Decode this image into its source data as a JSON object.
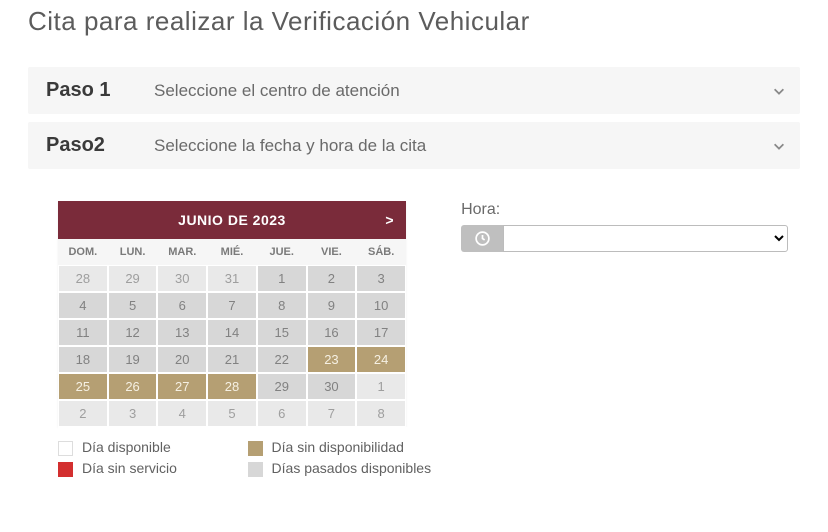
{
  "title": "Cita para realizar la Verificación Vehicular",
  "steps": [
    {
      "label": "Paso 1",
      "desc": "Seleccione el centro de atención"
    },
    {
      "label": "Paso2",
      "desc": "Seleccione la fecha y hora de la cita"
    }
  ],
  "calendar": {
    "month_title": "JUNIO DE 2023",
    "next_symbol": ">",
    "dow": [
      "DOM.",
      "LUN.",
      "MAR.",
      "MIÉ.",
      "JUE.",
      "VIE.",
      "SÁB."
    ],
    "weeks": [
      [
        {
          "n": "28",
          "s": "other"
        },
        {
          "n": "29",
          "s": "other"
        },
        {
          "n": "30",
          "s": "other"
        },
        {
          "n": "31",
          "s": "other"
        },
        {
          "n": "1",
          "s": "past-available"
        },
        {
          "n": "2",
          "s": "past-available"
        },
        {
          "n": "3",
          "s": "past-available"
        }
      ],
      [
        {
          "n": "4",
          "s": "past-available"
        },
        {
          "n": "5",
          "s": "past-available"
        },
        {
          "n": "6",
          "s": "past-available"
        },
        {
          "n": "7",
          "s": "past-available"
        },
        {
          "n": "8",
          "s": "past-available"
        },
        {
          "n": "9",
          "s": "past-available"
        },
        {
          "n": "10",
          "s": "past-available"
        }
      ],
      [
        {
          "n": "11",
          "s": "past-available"
        },
        {
          "n": "12",
          "s": "past-available"
        },
        {
          "n": "13",
          "s": "past-available"
        },
        {
          "n": "14",
          "s": "past-available"
        },
        {
          "n": "15",
          "s": "past-available"
        },
        {
          "n": "16",
          "s": "past-available"
        },
        {
          "n": "17",
          "s": "past-available"
        }
      ],
      [
        {
          "n": "18",
          "s": "past-available"
        },
        {
          "n": "19",
          "s": "past-available"
        },
        {
          "n": "20",
          "s": "past-available"
        },
        {
          "n": "21",
          "s": "past-available"
        },
        {
          "n": "22",
          "s": "past-available"
        },
        {
          "n": "23",
          "s": "nodisp"
        },
        {
          "n": "24",
          "s": "nodisp"
        }
      ],
      [
        {
          "n": "25",
          "s": "nodisp"
        },
        {
          "n": "26",
          "s": "nodisp"
        },
        {
          "n": "27",
          "s": "nodisp"
        },
        {
          "n": "28",
          "s": "nodisp"
        },
        {
          "n": "29",
          "s": "past-available"
        },
        {
          "n": "30",
          "s": "past-available"
        },
        {
          "n": "1",
          "s": "other"
        }
      ],
      [
        {
          "n": "2",
          "s": "other"
        },
        {
          "n": "3",
          "s": "other"
        },
        {
          "n": "4",
          "s": "other"
        },
        {
          "n": "5",
          "s": "other"
        },
        {
          "n": "6",
          "s": "other"
        },
        {
          "n": "7",
          "s": "other"
        },
        {
          "n": "8",
          "s": "other"
        }
      ]
    ]
  },
  "legend": {
    "available": "Día disponible",
    "nodisp": "Día sin disponibilidad",
    "noserv": "Día sin servicio",
    "past": "Días pasados disponibles"
  },
  "hora": {
    "label": "Hora:",
    "selected": ""
  }
}
